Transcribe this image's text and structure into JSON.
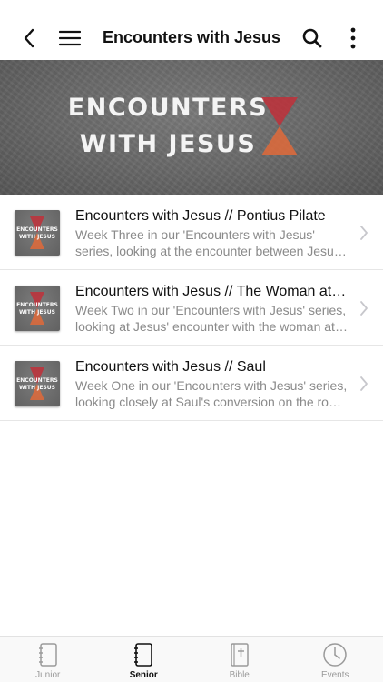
{
  "header": {
    "title": "Encounters with Jesus",
    "back_icon": "chevron-left-icon",
    "menu_icon": "hamburger-menu-icon",
    "search_icon": "search-icon",
    "more_icon": "more-vertical-icon"
  },
  "banner": {
    "line1": "ENCOUNTERS",
    "line2": "WITH JESUS",
    "accent_top": "#c0303a",
    "accent_bottom": "#e06a3a"
  },
  "thumbnail": {
    "line1": "ENCOUNTERS",
    "line2": "WITH JESUS"
  },
  "sermons": [
    {
      "title": "Encounters with Jesus // Pontius Pilate",
      "description": "Week Three in our 'Encounters with Jesus' series, looking at the encounter between Jesus and Pontius Pilate."
    },
    {
      "title": "Encounters with Jesus // The Woman at the Well",
      "description": "Week Two in our 'Encounters with Jesus' series, looking at Jesus' encounter with the woman at the well."
    },
    {
      "title": "Encounters with Jesus // Saul",
      "description": "Week One in our 'Encounters with Jesus' series, looking closely at Saul's conversion on the road to Damascus."
    }
  ],
  "tabs": [
    {
      "label": "Junior",
      "icon": "notebook-icon",
      "active": false
    },
    {
      "label": "Senior",
      "icon": "notebook-icon",
      "active": true
    },
    {
      "label": "Bible",
      "icon": "bible-icon",
      "active": false
    },
    {
      "label": "Events",
      "icon": "clock-icon",
      "active": false
    }
  ],
  "colors": {
    "text_primary": "#111111",
    "text_secondary": "#8a8a8a",
    "tab_inactive": "#9a9a9a"
  }
}
